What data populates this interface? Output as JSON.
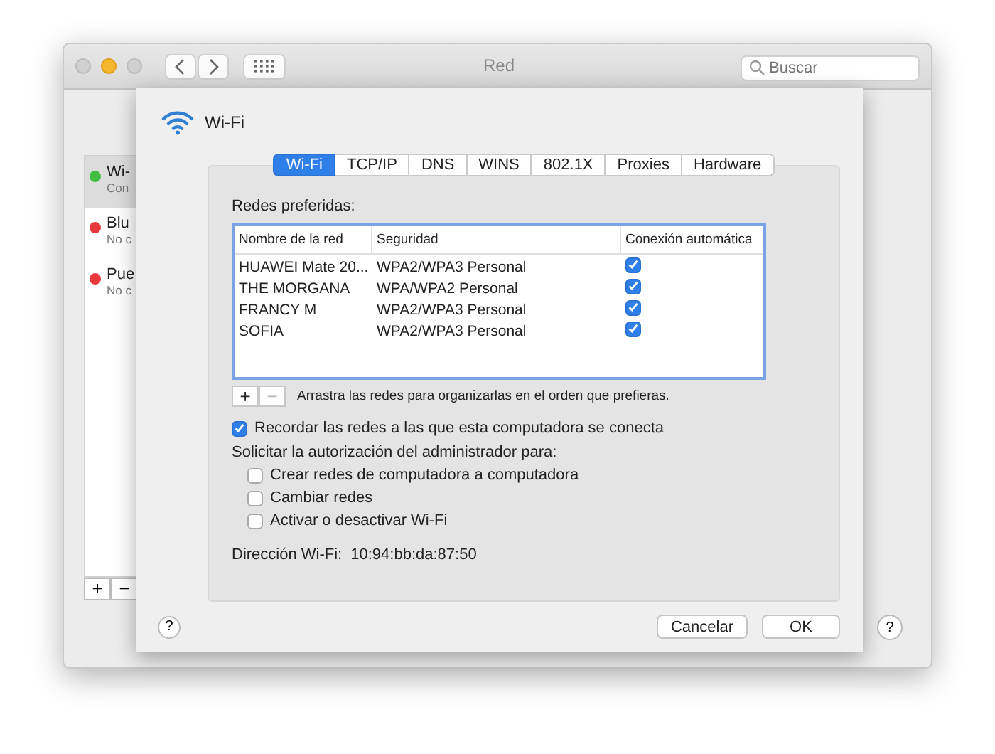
{
  "window": {
    "title": "Red",
    "search": {
      "placeholder": "Buscar"
    }
  },
  "sidebar": {
    "items": [
      {
        "name": "Wi-",
        "status": "Con",
        "color": "#3fbf3f",
        "selected": true
      },
      {
        "name": "Blu",
        "status": "No c",
        "color": "#e8383d",
        "selected": false
      },
      {
        "name": "Pue",
        "status": "No c",
        "color": "#e8383d",
        "selected": false
      }
    ],
    "buttons": [
      "+",
      "−"
    ]
  },
  "background_help": "?",
  "sheet": {
    "title": "Wi-Fi",
    "tabs": [
      {
        "label": "Wi-Fi",
        "selected": true
      },
      {
        "label": "TCP/IP",
        "selected": false
      },
      {
        "label": "DNS",
        "selected": false
      },
      {
        "label": "WINS",
        "selected": false
      },
      {
        "label": "802.1X",
        "selected": false
      },
      {
        "label": "Proxies",
        "selected": false
      },
      {
        "label": "Hardware",
        "selected": false
      }
    ],
    "preferred_label": "Redes preferidas:",
    "table": {
      "columns": [
        "Nombre de la red",
        "Seguridad",
        "Conexión automática"
      ],
      "rows": [
        {
          "name": "HUAWEI Mate 20...",
          "security": "WPA2/WPA3 Personal",
          "checked": true
        },
        {
          "name": "THE MORGANA",
          "security": "WPA/WPA2 Personal",
          "checked": true
        },
        {
          "name": "FRANCY M",
          "security": "WPA2/WPA3 Personal",
          "checked": true
        },
        {
          "name": "SOFIA",
          "security": "WPA2/WPA3 Personal",
          "checked": true
        }
      ]
    },
    "add": "+",
    "remove": "−",
    "drag_hint": "Arrastra las redes para organizarlas en el orden que prefieras.",
    "remember": {
      "label": "Recordar las redes a las que esta computadora se conecta",
      "checked": true
    },
    "admin_label": "Solicitar la autorización del administrador para:",
    "admin_options": [
      {
        "label": "Crear redes de computadora a computadora",
        "checked": false
      },
      {
        "label": "Cambiar redes",
        "checked": false
      },
      {
        "label": "Activar o desactivar Wi-Fi",
        "checked": false
      }
    ],
    "address_label": "Dirección Wi-Fi:",
    "address": "10:94:bb:da:87:50",
    "help": "?",
    "buttons": [
      {
        "label": "Cancelar",
        "kind": "cancel"
      },
      {
        "label": "OK",
        "kind": "ok"
      }
    ]
  }
}
